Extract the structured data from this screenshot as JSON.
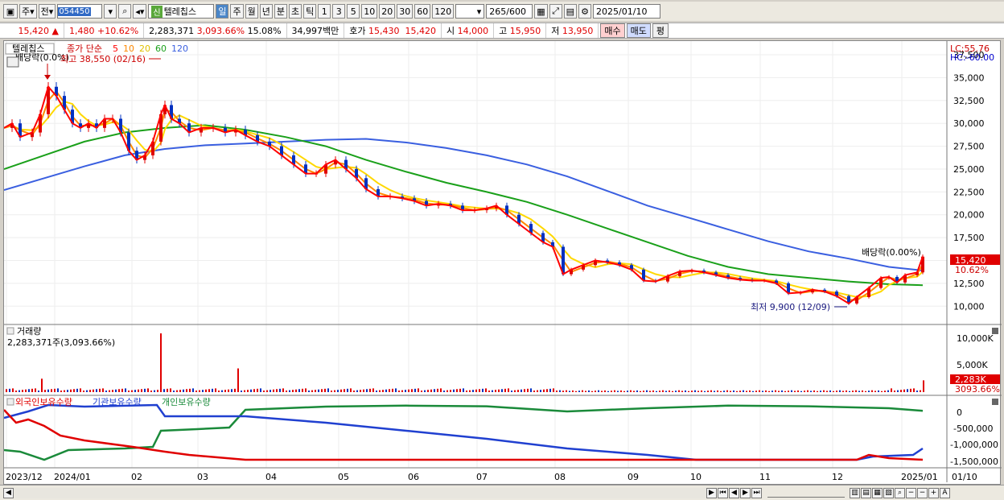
{
  "toolbar": {
    "market_label": "주",
    "market2": "전",
    "code": "054450",
    "new_tag": "신",
    "stock_name": "텔레칩스",
    "periods": [
      "일",
      "주",
      "월",
      "년",
      "분",
      "초",
      "틱"
    ],
    "nums": [
      "1",
      "3",
      "5",
      "10",
      "20",
      "30",
      "60",
      "120"
    ],
    "count": "265",
    "count_max": "/600",
    "date": "2025/01/10"
  },
  "quote": {
    "price": "15,420",
    "change": "1,480",
    "change_pct": "+10.62%",
    "volume": "2,283,371",
    "vol_pct": "3,093.66%",
    "turnover": "15.08%",
    "amount": "34,997백만",
    "bid_label": "호가",
    "bid1": "15,430",
    "bid2": "15,420",
    "open_label": "시",
    "open": "14,000",
    "high_label": "고",
    "high": "15,950",
    "low_label": "저",
    "low": "13,950",
    "buy": "매수",
    "sell": "매도",
    "avg": "평"
  },
  "price_panel": {
    "name": "텔레칩스",
    "ma_label": "종가 단순",
    "ma_periods": [
      "5",
      "10",
      "20",
      "60",
      "120"
    ],
    "ma_colors": [
      "#ff0000",
      "#ff8800",
      "#ffd800",
      "#1aa01a",
      "#3a5fe0"
    ],
    "lc": "LC:55.76",
    "hc": "HC:-60.00",
    "annot_dividend1": "배당락(0.0%)",
    "annot_high": "최고 38,550 (02/16)",
    "annot_dividend2": "배당락(0.00%)",
    "annot_low": "최저 9,900 (12/09)",
    "price_tag": "15,420",
    "pct_tag": "10.62%",
    "y_labels": [
      "37,500",
      "35,000",
      "32,500",
      "30,000",
      "27,500",
      "25,000",
      "22,500",
      "20,000",
      "17,500",
      "15,000",
      "12,500",
      "10,000"
    ]
  },
  "volume_panel": {
    "title": "거래량",
    "value": "2,283,371주(3,093.66%)",
    "y_labels": [
      "10,000K",
      "5,000K"
    ],
    "tag1": "2,283K",
    "tag2": "3093.66%"
  },
  "holder_panel": {
    "foreign": "외국인보유수량",
    "inst": "기관보유수량",
    "indiv": "개인보유수량",
    "y_labels": [
      "0",
      "-500,000",
      "-1,000,000",
      "-1,500,000"
    ]
  },
  "x_axis": [
    "2023/12",
    "2024/01",
    "02",
    "03",
    "04",
    "05",
    "06",
    "07",
    "08",
    "09",
    "10",
    "11",
    "12",
    "2025/01",
    "01/10"
  ],
  "chart_data": {
    "type": "line",
    "price_close": [
      [
        0,
        29500
      ],
      [
        10,
        30000
      ],
      [
        20,
        28500
      ],
      [
        35,
        29000
      ],
      [
        45,
        31000
      ],
      [
        55,
        34000
      ],
      [
        65,
        33000
      ],
      [
        75,
        31500
      ],
      [
        85,
        30000
      ],
      [
        95,
        29500
      ],
      [
        105,
        30000
      ],
      [
        115,
        29500
      ],
      [
        125,
        30500
      ],
      [
        135,
        30500
      ],
      [
        145,
        29000
      ],
      [
        155,
        27000
      ],
      [
        165,
        26000
      ],
      [
        175,
        26500
      ],
      [
        185,
        28000
      ],
      [
        195,
        31000
      ],
      [
        200,
        32000
      ],
      [
        208,
        30500
      ],
      [
        218,
        30000
      ],
      [
        230,
        29000
      ],
      [
        245,
        29500
      ],
      [
        260,
        29500
      ],
      [
        275,
        29000
      ],
      [
        288,
        29300
      ],
      [
        300,
        28700
      ],
      [
        315,
        28000
      ],
      [
        330,
        27500
      ],
      [
        345,
        26500
      ],
      [
        360,
        25500
      ],
      [
        375,
        24500
      ],
      [
        388,
        24500
      ],
      [
        400,
        25500
      ],
      [
        412,
        26000
      ],
      [
        425,
        25000
      ],
      [
        438,
        24000
      ],
      [
        450,
        22800
      ],
      [
        465,
        22000
      ],
      [
        480,
        22000
      ],
      [
        495,
        21800
      ],
      [
        510,
        21500
      ],
      [
        525,
        21000
      ],
      [
        540,
        21200
      ],
      [
        555,
        21000
      ],
      [
        570,
        20500
      ],
      [
        585,
        20500
      ],
      [
        600,
        20700
      ],
      [
        612,
        21000
      ],
      [
        625,
        20000
      ],
      [
        640,
        19000
      ],
      [
        655,
        18000
      ],
      [
        670,
        17000
      ],
      [
        682,
        16500
      ],
      [
        695,
        13500
      ],
      [
        705,
        14000
      ],
      [
        720,
        14500
      ],
      [
        735,
        15000
      ],
      [
        750,
        14800
      ],
      [
        765,
        14500
      ],
      [
        780,
        14000
      ],
      [
        795,
        12800
      ],
      [
        810,
        12700
      ],
      [
        825,
        13300
      ],
      [
        840,
        13800
      ],
      [
        855,
        13900
      ],
      [
        870,
        13700
      ],
      [
        885,
        13400
      ],
      [
        900,
        13100
      ],
      [
        915,
        12900
      ],
      [
        930,
        12800
      ],
      [
        945,
        12800
      ],
      [
        960,
        12500
      ],
      [
        975,
        11400
      ],
      [
        990,
        11500
      ],
      [
        1005,
        11800
      ],
      [
        1020,
        11600
      ],
      [
        1035,
        11100
      ],
      [
        1050,
        10300
      ],
      [
        1060,
        11000
      ],
      [
        1075,
        12000
      ],
      [
        1090,
        13100
      ],
      [
        1100,
        13200
      ],
      [
        1110,
        12600
      ],
      [
        1120,
        13400
      ],
      [
        1135,
        13700
      ],
      [
        1142,
        15420
      ]
    ],
    "ma60": [
      [
        0,
        25000
      ],
      [
        50,
        26500
      ],
      [
        100,
        28000
      ],
      [
        150,
        29000
      ],
      [
        200,
        29500
      ],
      [
        250,
        29800
      ],
      [
        300,
        29300
      ],
      [
        350,
        28500
      ],
      [
        400,
        27500
      ],
      [
        450,
        26000
      ],
      [
        500,
        24700
      ],
      [
        550,
        23500
      ],
      [
        600,
        22500
      ],
      [
        650,
        21400
      ],
      [
        700,
        20000
      ],
      [
        750,
        18500
      ],
      [
        800,
        17000
      ],
      [
        850,
        15500
      ],
      [
        900,
        14300
      ],
      [
        950,
        13500
      ],
      [
        1000,
        13100
      ],
      [
        1050,
        12700
      ],
      [
        1100,
        12400
      ],
      [
        1142,
        12300
      ]
    ],
    "ma120": [
      [
        0,
        22700
      ],
      [
        50,
        24000
      ],
      [
        100,
        25300
      ],
      [
        150,
        26500
      ],
      [
        200,
        27200
      ],
      [
        250,
        27600
      ],
      [
        300,
        27800
      ],
      [
        350,
        28000
      ],
      [
        400,
        28200
      ],
      [
        450,
        28300
      ],
      [
        500,
        27900
      ],
      [
        550,
        27300
      ],
      [
        600,
        26500
      ],
      [
        650,
        25500
      ],
      [
        700,
        24200
      ],
      [
        750,
        22600
      ],
      [
        800,
        21000
      ],
      [
        850,
        19700
      ],
      [
        900,
        18400
      ],
      [
        950,
        17100
      ],
      [
        1000,
        16000
      ],
      [
        1050,
        15200
      ],
      [
        1100,
        14300
      ],
      [
        1142,
        13900
      ]
    ],
    "price_range": [
      8000,
      39000
    ],
    "volume_thousands": [
      [
        45,
        2600
      ],
      [
        195,
        11400
      ],
      [
        290,
        4600
      ],
      [
        1142,
        2283
      ]
    ],
    "holder_range": [
      -1800000,
      300000
    ]
  }
}
